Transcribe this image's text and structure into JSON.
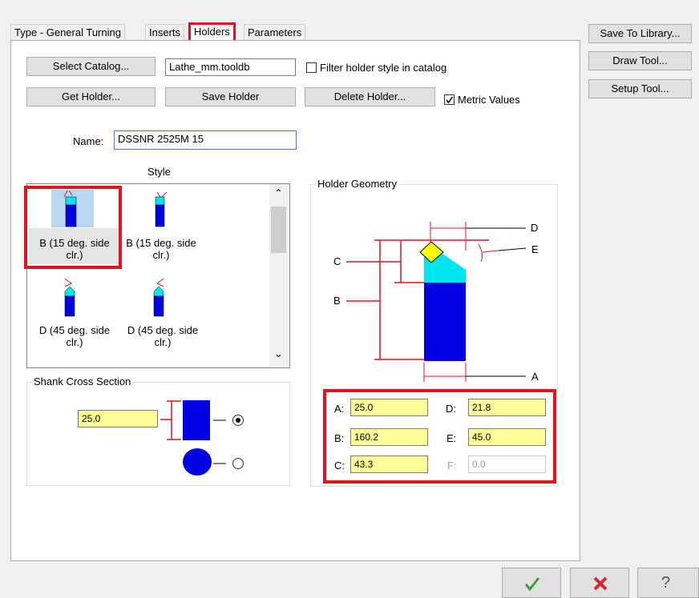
{
  "tabs": [
    "Type - General Turning",
    "Inserts",
    "Holders",
    "Parameters"
  ],
  "right_buttons": [
    "Save To Library...",
    "Draw Tool...",
    "Setup Tool..."
  ],
  "buttons": {
    "select_catalog": "Select Catalog...",
    "get_holder": "Get Holder...",
    "save_holder": "Save Holder",
    "delete_holder": "Delete Holder..."
  },
  "catalog_file": "Lathe_mm.tooldb",
  "filter_label": "Filter holder style in catalog",
  "metric_label": "Metric Values",
  "metric_checked": true,
  "name_label": "Name:",
  "name_value": "DSSNR 2525M 15",
  "style_heading": "Style",
  "style_items": [
    {
      "line1": "B (15 deg. side",
      "line2": "clr.)"
    },
    {
      "line1": "B (15 deg. side",
      "line2": "clr.)"
    },
    {
      "line1": "D (45 deg. side",
      "line2": "clr.)"
    },
    {
      "line1": "D (45 deg. side",
      "line2": "clr.)"
    }
  ],
  "shank_heading": "Shank Cross Section",
  "shank_value": "25.0",
  "geometry_heading": "Holder Geometry",
  "geometry_letters": {
    "a": "A",
    "b": "B",
    "c": "C",
    "d": "D",
    "e": "E"
  },
  "geometry_fields": {
    "a_label": "A:",
    "a": "25.0",
    "b_label": "B:",
    "b": "160.2",
    "c_label": "C:",
    "c": "43.3",
    "d_label": "D:",
    "d": "21.8",
    "e_label": "E:",
    "e": "45.0",
    "f_label": "F:",
    "f": "0.0"
  },
  "icons": [
    "scroll-up-arrow",
    "scroll-down-arrow",
    "ok-checkmark",
    "cancel-x",
    "help-question"
  ],
  "colors": {
    "highlight": "#e0141e",
    "field_yellow": "#ffff99",
    "holder_blue": "#0000e0",
    "insert_cyan": "#00e5ee",
    "insert_yellow": "#ffff00"
  }
}
